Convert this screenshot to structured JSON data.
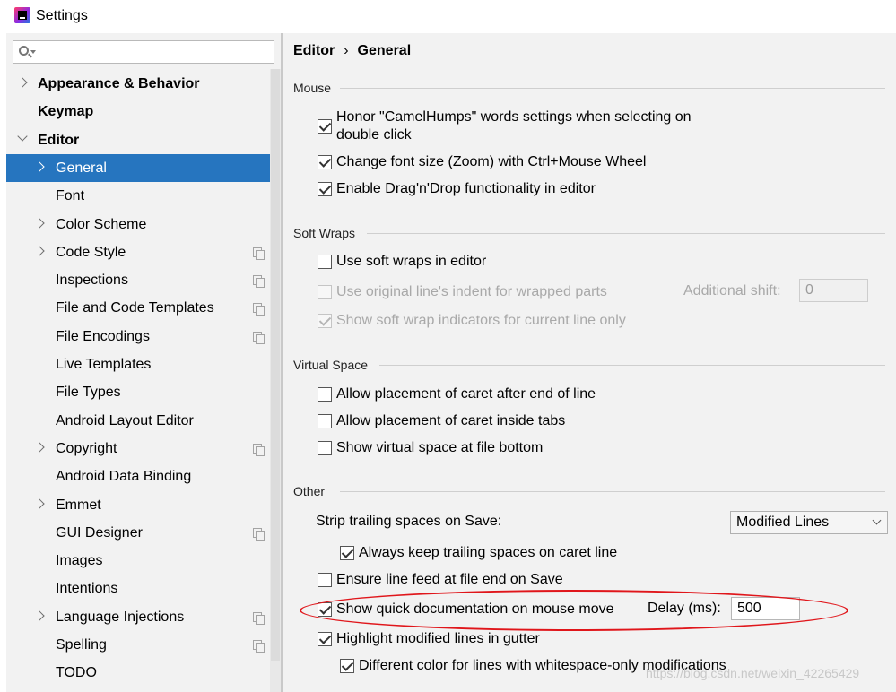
{
  "window": {
    "title": "Settings"
  },
  "sidebar": {
    "search_placeholder": "",
    "items": [
      {
        "label": "Appearance & Behavior",
        "bold": true,
        "chevron": "right"
      },
      {
        "label": "Keymap",
        "bold": true
      },
      {
        "label": "Editor",
        "bold": true,
        "chevron": "down"
      },
      {
        "label": "General",
        "chevron": "right",
        "selected": true
      },
      {
        "label": "Font"
      },
      {
        "label": "Color Scheme",
        "chevron": "right"
      },
      {
        "label": "Code Style",
        "chevron": "right",
        "copy_icon": true
      },
      {
        "label": "Inspections",
        "copy_icon": true
      },
      {
        "label": "File and Code Templates",
        "copy_icon": true
      },
      {
        "label": "File Encodings",
        "copy_icon": true
      },
      {
        "label": "Live Templates"
      },
      {
        "label": "File Types"
      },
      {
        "label": "Android Layout Editor"
      },
      {
        "label": "Copyright",
        "chevron": "right",
        "copy_icon": true
      },
      {
        "label": "Android Data Binding"
      },
      {
        "label": "Emmet",
        "chevron": "right"
      },
      {
        "label": "GUI Designer",
        "copy_icon": true
      },
      {
        "label": "Images"
      },
      {
        "label": "Intentions"
      },
      {
        "label": "Language Injections",
        "chevron": "right",
        "copy_icon": true
      },
      {
        "label": "Spelling",
        "copy_icon": true
      },
      {
        "label": "TODO"
      }
    ]
  },
  "breadcrumb": {
    "parent": "Editor",
    "separator": "›",
    "current": "General"
  },
  "mouse": {
    "header": "Mouse",
    "camel_line1": "Honor \"CamelHumps\" words settings when selecting on",
    "camel_line2": "double click",
    "camel_checked": true,
    "zoom_label": "Change font size (Zoom) with Ctrl+Mouse Wheel",
    "zoom_checked": true,
    "dnd_label": "Enable Drag'n'Drop functionality in editor",
    "dnd_checked": true
  },
  "soft_wraps": {
    "header": "Soft Wraps",
    "use_label": "Use soft wraps in editor",
    "use_checked": false,
    "indent_label": "Use original line's indent for wrapped parts",
    "indent_checked": false,
    "shift_label": "Additional shift:",
    "shift_value": "0",
    "indicator_label": "Show soft wrap indicators for current line only",
    "indicator_checked": true
  },
  "virtual_space": {
    "header": "Virtual Space",
    "after_eol_label": "Allow placement of caret after end of line",
    "inside_tabs_label": "Allow placement of caret inside tabs",
    "file_bottom_label": "Show virtual space at file bottom"
  },
  "other": {
    "header": "Other",
    "strip_label": "Strip trailing spaces on Save:",
    "strip_value": "Modified Lines",
    "keep_caret_label": "Always keep trailing spaces on caret line",
    "keep_caret_checked": true,
    "line_feed_label": "Ensure line feed at file end on Save",
    "line_feed_checked": false,
    "quick_doc_label": "Show quick documentation on mouse move",
    "quick_doc_checked": true,
    "delay_label": "Delay (ms):",
    "delay_value": "500",
    "highlight_label": "Highlight modified lines in gutter",
    "highlight_checked": true,
    "diff_color_label": "Different color for lines with whitespace-only modifications",
    "diff_color_checked": true
  },
  "watermark": "https://blog.csdn.net/weixin_42265429",
  "colors": {
    "selection": "#2675bf",
    "annotation": "#e0161b"
  }
}
